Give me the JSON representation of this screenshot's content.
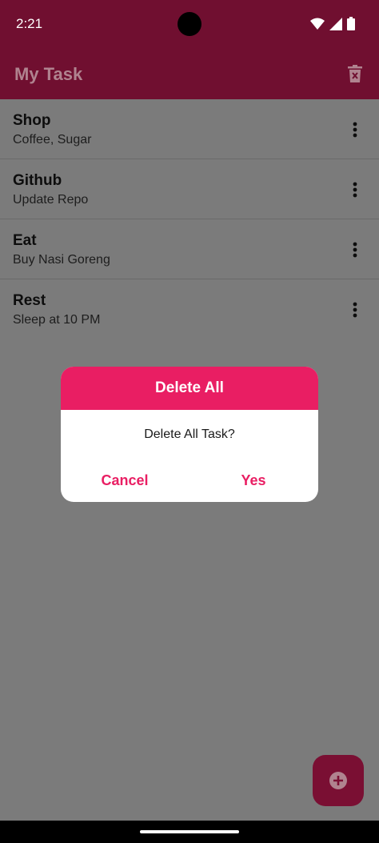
{
  "status_bar": {
    "time": "2:21"
  },
  "app_bar": {
    "title": "My Task",
    "action_icon": "delete-sweep-icon"
  },
  "tasks": [
    {
      "title": "Shop",
      "subtitle": "Coffee, Sugar"
    },
    {
      "title": "Github",
      "subtitle": "Update Repo"
    },
    {
      "title": "Eat",
      "subtitle": "Buy Nasi Goreng"
    },
    {
      "title": "Rest",
      "subtitle": "Sleep at 10 PM"
    }
  ],
  "dialog": {
    "title": "Delete All",
    "message": "Delete All Task?",
    "cancel_label": "Cancel",
    "confirm_label": "Yes"
  },
  "fab": {
    "icon": "add-circle-icon"
  },
  "colors": {
    "primary_dark": "#700f30",
    "accent": "#e91e63",
    "scrim_background": "#7b7b7b"
  }
}
